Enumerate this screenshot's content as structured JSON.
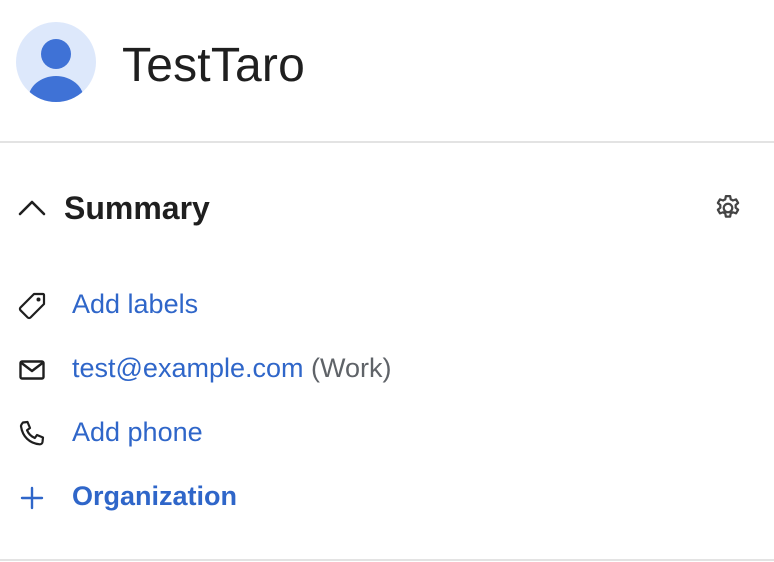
{
  "contact": {
    "name": "TestTaro"
  },
  "summary": {
    "title": "Summary",
    "labels_action": "Add labels",
    "email": "test@example.com",
    "email_type": "(Work)",
    "phone_action": "Add phone",
    "organization_action": "Organization"
  },
  "icons": {
    "avatar": "person-avatar-icon",
    "collapse": "chevron-up-icon",
    "settings": "gear-icon",
    "label": "label-tag-icon",
    "email": "mail-icon",
    "phone": "phone-icon",
    "add": "plus-icon"
  },
  "colors": {
    "accent": "#2f66c9",
    "avatar_bg": "#dde8fb",
    "avatar_fg": "#3f72d6",
    "divider": "#e3e3e3",
    "secondary_text": "#5f6368"
  }
}
